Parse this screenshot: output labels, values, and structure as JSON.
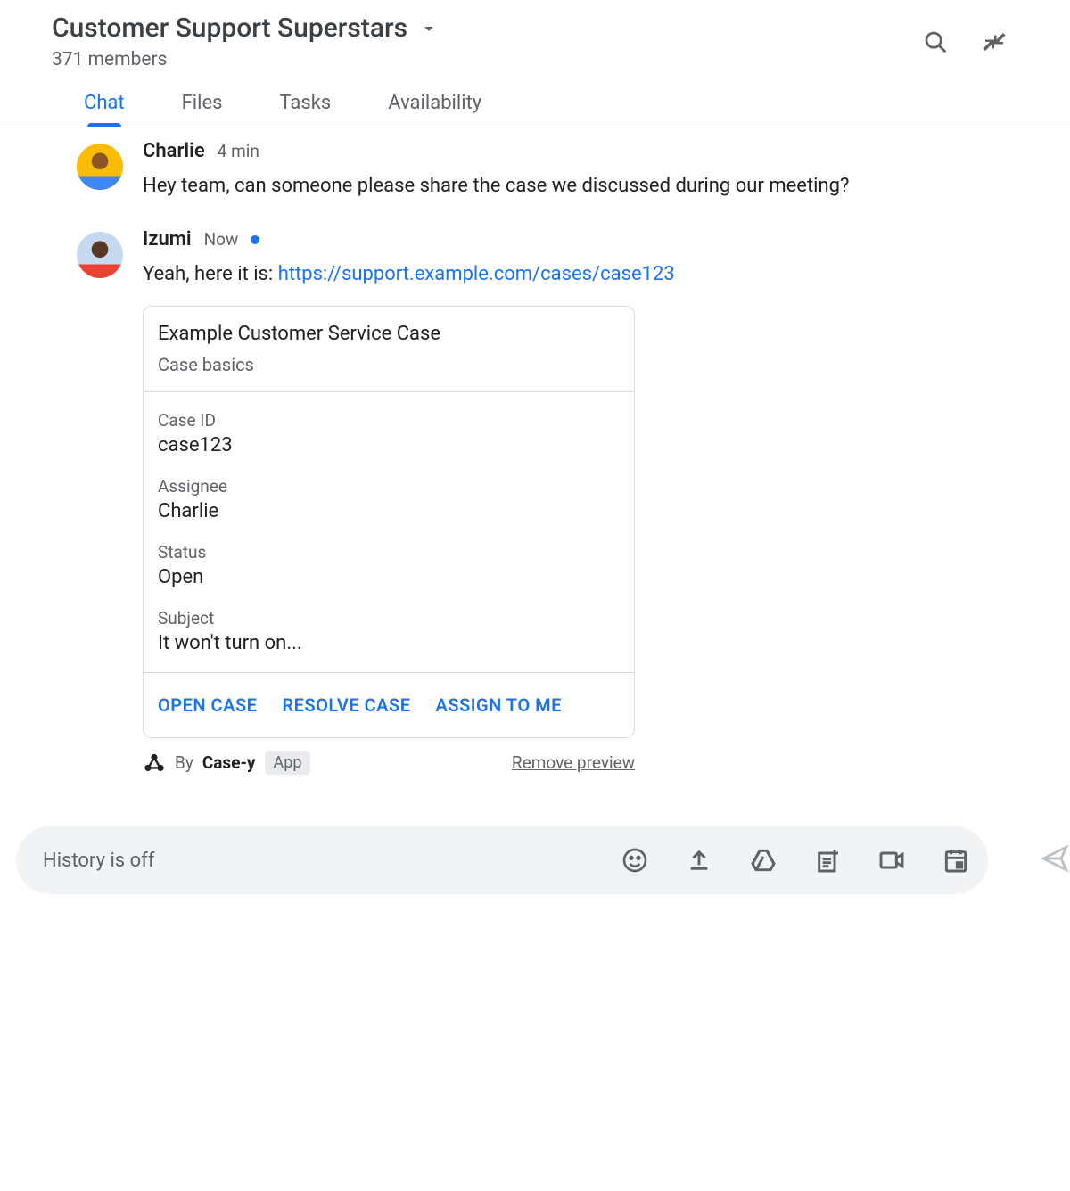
{
  "header": {
    "title": "Customer Support Superstars",
    "members": "371 members"
  },
  "tabs": [
    {
      "label": "Chat",
      "active": true
    },
    {
      "label": "Files",
      "active": false
    },
    {
      "label": "Tasks",
      "active": false
    },
    {
      "label": "Availability",
      "active": false
    }
  ],
  "messages": [
    {
      "author": "Charlie",
      "timestamp": "4 min",
      "hasDot": false,
      "body": "Hey team, can someone please share the case we discussed during our meeting?"
    },
    {
      "author": "Izumi",
      "timestamp": "Now",
      "hasDot": true,
      "bodyPrefix": "Yeah, here it is: ",
      "link": "https://support.example.com/cases/case123"
    }
  ],
  "card": {
    "title": "Example Customer Service Case",
    "subtitle": "Case basics",
    "fields": [
      {
        "label": "Case ID",
        "value": "case123"
      },
      {
        "label": "Assignee",
        "value": "Charlie"
      },
      {
        "label": "Status",
        "value": "Open"
      },
      {
        "label": "Subject",
        "value": "It won't turn on..."
      }
    ],
    "actions": [
      "OPEN CASE",
      "RESOLVE CASE",
      "ASSIGN TO ME"
    ],
    "footer": {
      "byPrefix": "By ",
      "appName": "Case-y",
      "appBadge": "App",
      "remove": "Remove preview"
    }
  },
  "composer": {
    "placeholder": "History is off"
  }
}
